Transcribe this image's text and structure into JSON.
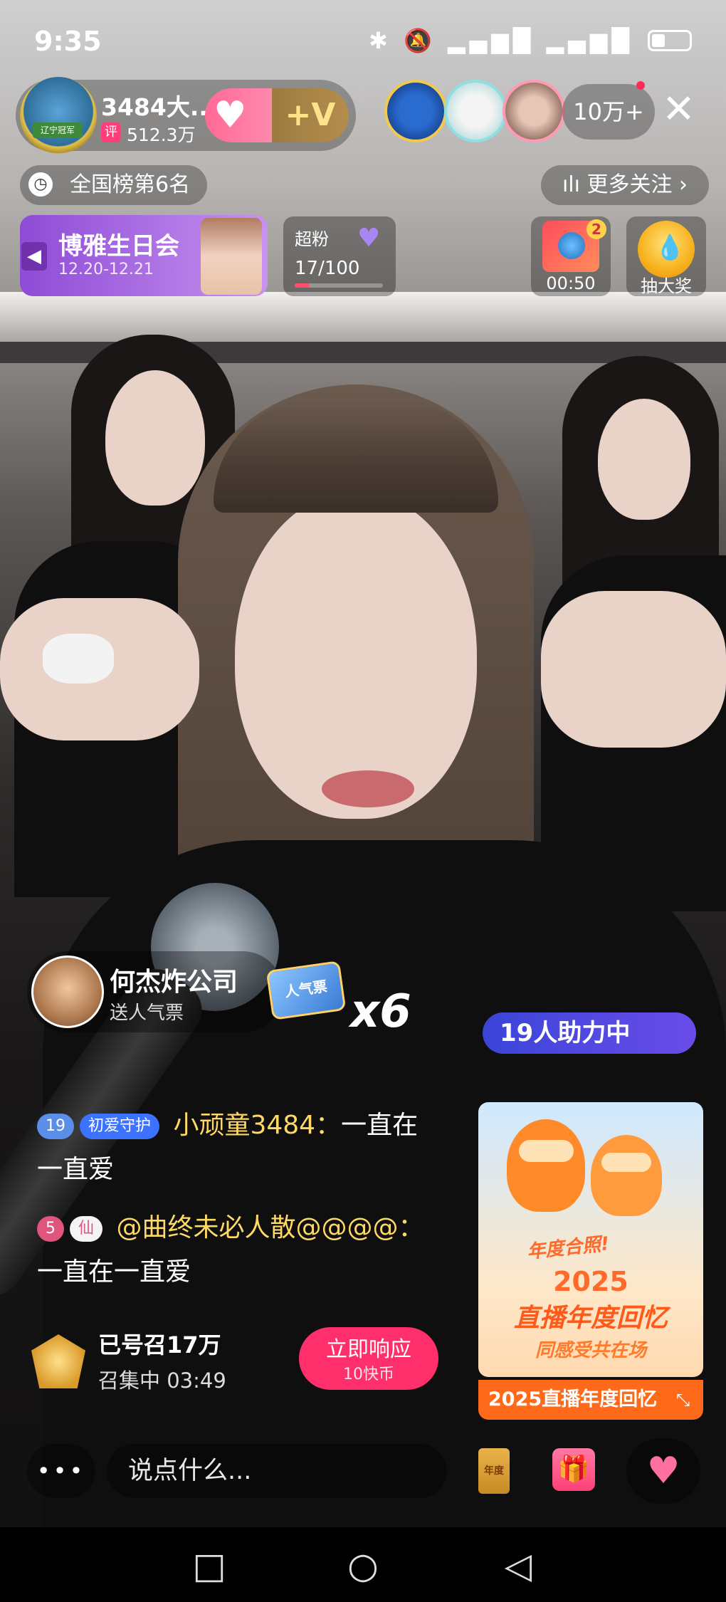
{
  "status_bar": {
    "time": "9:35",
    "icons": "✱ 🔕 ⁴ᴳ▂▄▆█ ▂▄▆█",
    "battery_level": 0.35
  },
  "host": {
    "badge_label": "辽宁冠军",
    "name": "3484大...",
    "score_tag": "评",
    "score": "512.3万",
    "vip_label": "+V"
  },
  "viewers": {
    "count": "10万+"
  },
  "rank": {
    "label": "全国榜第6名"
  },
  "follow": {
    "label": "更多关注"
  },
  "event": {
    "title": "博雅生日会",
    "dates": "12.20-12.21"
  },
  "super_fan": {
    "title": "超粉",
    "progress": "17/100",
    "progress_fraction": 0.17
  },
  "widgets": {
    "box_badge": "2",
    "box_timer": "00:50",
    "lottery_label": "抽大奖"
  },
  "gift": {
    "user": "何杰炸公司",
    "action": "送人气票",
    "item_label": "人气票",
    "multiplier": "x6"
  },
  "chat": [
    {
      "level": "19",
      "badge": "初爱守护",
      "user": "小顽童3484",
      "text": "一直在一直爱"
    },
    {
      "level": "5",
      "badge": "仙",
      "user": "@曲终未必人散@@@@",
      "text": "一直在一直爱"
    }
  ],
  "rally": {
    "title": "已号召17万",
    "status": "召集中 03:49",
    "button_title": "立即响应",
    "button_cost": "10快币"
  },
  "promo": {
    "helpers": "19人助力中",
    "tag": "年度合照!",
    "year": "2025",
    "title": "直播年度回忆",
    "subtitle": "同感受共在场",
    "bar_label": "2025直播年度回忆"
  },
  "bottom": {
    "placeholder": "说点什么...",
    "more": "•••",
    "envelope_label": "年度"
  }
}
